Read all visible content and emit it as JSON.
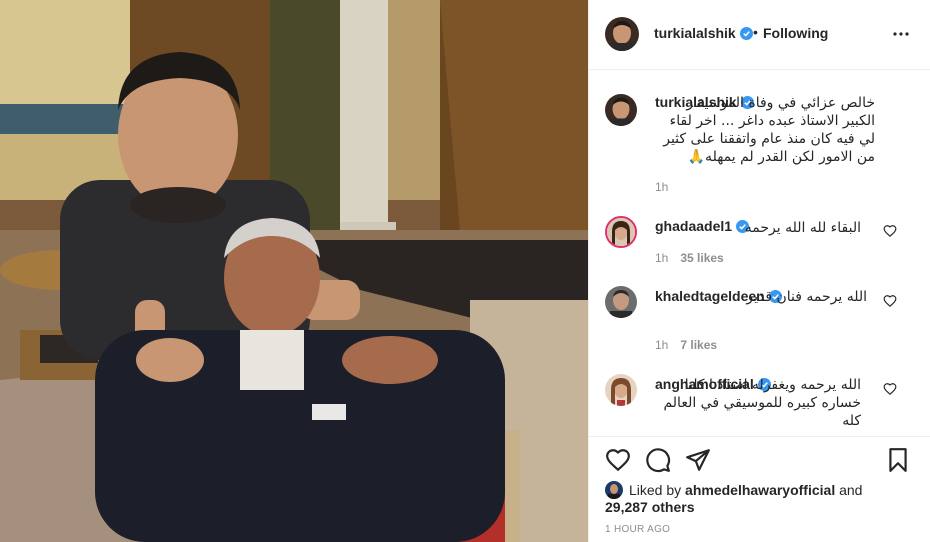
{
  "post": {
    "author": "turkialalshik",
    "follow_state": "Following",
    "dot": "•"
  },
  "caption": {
    "username": "turkialalshik",
    "text": "خالص عزائي في وفاة الموسيقار الكبير الاستاذ عبده داغر ... اخر لقاء لي فيه كان منذ عام واتفقنا على كثير من الامور لكن القدر لم يمهله🙏",
    "time": "1h"
  },
  "comments": [
    {
      "username": "ghadaadel1",
      "text": "البقاء لله الله يرحمه",
      "time": "1h",
      "likes": "35 likes"
    },
    {
      "username": "khaledtageldeen",
      "text": "الله يرحمه فنان قدير",
      "time": "1h",
      "likes": "7 likes"
    },
    {
      "username": "anghamofficial",
      "text": "الله يرحمه ويغفرله استاذنا كلنا خساره كبيره للموسيقي في العالم كله",
      "time": "",
      "likes": ""
    }
  ],
  "likes": {
    "prefix": "Liked by",
    "user": "ahmedelhawaryofficial",
    "and": "and",
    "count": "29,287 others"
  },
  "timestamp": "1 HOUR AGO",
  "icons": {
    "verified": "verified-badge-icon",
    "more": "more-options-icon",
    "like": "heart-icon",
    "comment": "comment-icon",
    "share": "paper-plane-icon",
    "save": "bookmark-icon"
  },
  "colors": {
    "verified": "#3897f0",
    "meta_text": "#8e8e8e",
    "border": "#efefef"
  }
}
